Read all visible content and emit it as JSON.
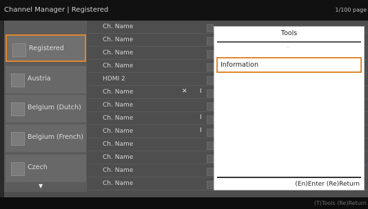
{
  "header": {
    "title": "Channel Manager | Registered",
    "pages": "1/100 page"
  },
  "categories": [
    {
      "label": "Registered",
      "selected": true
    },
    {
      "label": "Austria",
      "selected": false
    },
    {
      "label": "Belgium (Dutch)",
      "selected": false
    },
    {
      "label": "Belgium (French)",
      "selected": false
    },
    {
      "label": "Czech",
      "selected": false
    }
  ],
  "more_icon": "down-arrow-icon",
  "channels": [
    {
      "name": "Ch. Name",
      "icons": []
    },
    {
      "name": "Ch. Name",
      "icons": []
    },
    {
      "name": "Ch. Name",
      "icons": []
    },
    {
      "name": "Ch. Name",
      "icons": []
    },
    {
      "name": "HDMI 2",
      "icons": []
    },
    {
      "name": "Ch. Name",
      "icons": [
        "no-sound-icon",
        "edit-icon"
      ]
    },
    {
      "name": "Ch. Name",
      "icons": []
    },
    {
      "name": "Ch. Name",
      "icons": [
        "edit-icon"
      ]
    },
    {
      "name": "Ch. Name",
      "icons": [
        "edit-icon"
      ]
    },
    {
      "name": "Ch. Name",
      "icons": []
    },
    {
      "name": "Ch. Name",
      "icons": []
    },
    {
      "name": "Ch. Name",
      "icons": []
    },
    {
      "name": "Ch. Name",
      "icons": []
    }
  ],
  "popup": {
    "title": "Tools",
    "item": "Information",
    "footer": "(En)Enter  (Re)Return"
  },
  "footer_hint": "(T)Tools  (Re)Return",
  "colors": {
    "highlight": "#e0872e",
    "pointer": "#1f6fc9"
  }
}
